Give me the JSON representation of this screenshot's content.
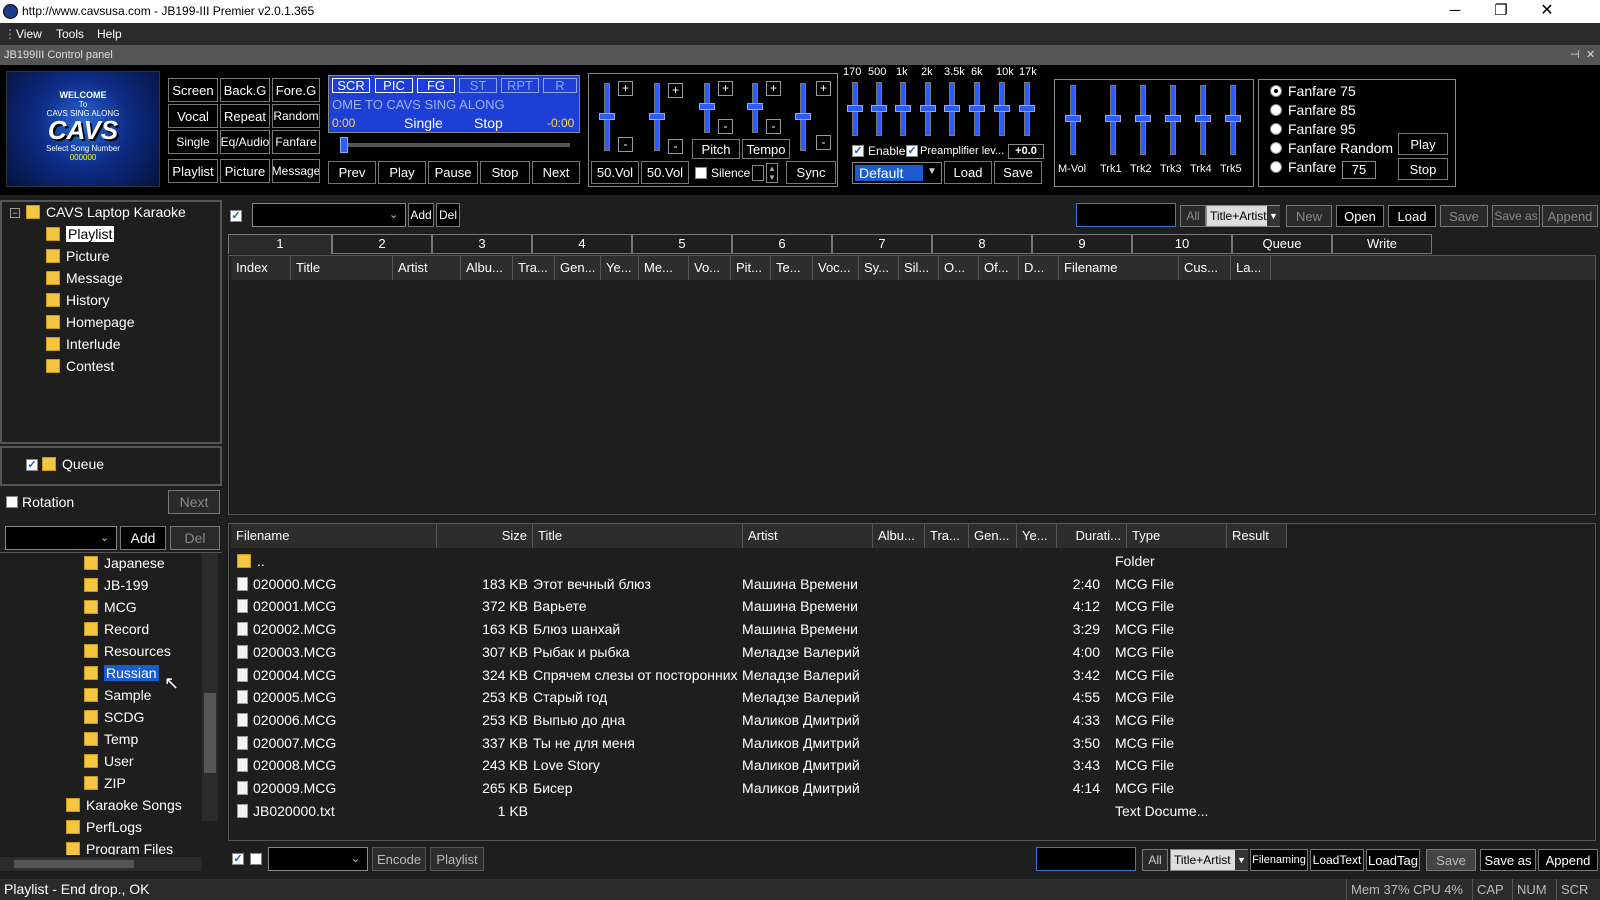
{
  "window": {
    "title": "http://www.cavsusa.com - JB199-III Premier v2.0.1.365",
    "min": "─",
    "restore": "❐",
    "close": "✕"
  },
  "menu": {
    "items": [
      "View",
      "Tools",
      "Help"
    ]
  },
  "control_panel": {
    "title": "JB199III Control panel",
    "logo": {
      "welcome": "WELCOME",
      "to": "To",
      "tagline": "CAVS SING ALONG",
      "brand": "CAVS",
      "select": "Select Song Number",
      "number": "000000"
    },
    "mode_buttons": [
      "Screen",
      "Back.G",
      "Fore.G",
      "Vocal",
      "Repeat",
      "Random",
      "Single",
      "Eq/Audio",
      "Fanfare",
      "Playlist",
      "Picture",
      "Message"
    ],
    "display": {
      "tags": [
        "SCR",
        "PIC",
        "FG",
        "ST",
        "RPT",
        "R"
      ],
      "marquee": "OME TO CAVS SING ALONG",
      "elapsed": "0:00",
      "mode": "Single",
      "state": "Stop",
      "remaining": "-0:00"
    },
    "transport": [
      "Prev",
      "Play",
      "Pause",
      "Stop",
      "Next"
    ],
    "vol": {
      "plus": "+",
      "minus": "-",
      "vol1": "50.Vol",
      "vol2": "50.Vol",
      "pitch": "Pitch",
      "tempo": "Tempo",
      "silence": "Silence",
      "sync": "Sync"
    },
    "eq": {
      "freqs": [
        "170",
        "500",
        "1k",
        "2k",
        "3.5k",
        "6k",
        "10k",
        "17k"
      ],
      "enable": "Enable",
      "preamp": "Preamplifier lev...",
      "preamp_val": "+0.0",
      "preset": "Default",
      "load": "Load",
      "save": "Save"
    },
    "mixer": {
      "labels": [
        "M-Vol",
        "Trk1",
        "Trk2",
        "Trk3",
        "Trk4",
        "Trk5"
      ]
    },
    "fanfare": {
      "options": [
        "Fanfare 75",
        "Fanfare 85",
        "Fanfare 95",
        "Fanfare Random",
        "Fanfare"
      ],
      "value": "75",
      "play": "Play",
      "stop": "Stop"
    }
  },
  "tree": {
    "root": "CAVS Laptop Karaoke",
    "items": [
      "Playlist",
      "Picture",
      "Message",
      "History",
      "Homepage",
      "Interlude",
      "Contest"
    ]
  },
  "queue": {
    "label": "Queue",
    "rotation": "Rotation",
    "next": "Next"
  },
  "folder_bar": {
    "add": "Add",
    "del": "Del"
  },
  "folders": {
    "items": [
      "Japanese",
      "JB-199",
      "MCG",
      "Record",
      "Resources",
      "Russian",
      "Sample",
      "SCDG",
      "Temp",
      "User",
      "ZIP"
    ],
    "top": [
      "Karaoke Songs",
      "PerfLogs",
      "Program Files"
    ]
  },
  "playlist_toolbar": {
    "add": "Add",
    "del": "Del",
    "all": "All",
    "sort": "Title+Artist",
    "new": "New",
    "open": "Open",
    "load": "Load",
    "save": "Save",
    "saveas": "Save as",
    "append": "Append"
  },
  "playlist_tabs": [
    "1",
    "2",
    "3",
    "4",
    "5",
    "6",
    "7",
    "8",
    "9",
    "10",
    "Queue",
    "Write"
  ],
  "playlist_columns": [
    "Index",
    "Title",
    "Artist",
    "Albu...",
    "Tra...",
    "Gen...",
    "Ye...",
    "Me...",
    "Vo...",
    "Pit...",
    "Te...",
    "Voc...",
    "Sy...",
    "Sil...",
    "O...",
    "Of...",
    "D...",
    "Filename",
    "Cus...",
    "La..."
  ],
  "file_columns": [
    "Filename",
    "Size",
    "Title",
    "Artist",
    "Albu...",
    "Tra...",
    "Gen...",
    "Ye...",
    "Durati...",
    "Type",
    "Result"
  ],
  "files": [
    {
      "name": "..",
      "size": "",
      "title": "",
      "artist": "",
      "dur": "",
      "type": "Folder",
      "icon": "folder"
    },
    {
      "name": "020000.MCG",
      "size": "183 KB",
      "title": "Этот вечный блюз",
      "artist": "Машина Времени",
      "dur": "2:40",
      "type": "MCG File",
      "icon": "file"
    },
    {
      "name": "020001.MCG",
      "size": "372 KB",
      "title": "Варьете",
      "artist": "Машина Времени",
      "dur": "4:12",
      "type": "MCG File",
      "icon": "file"
    },
    {
      "name": "020002.MCG",
      "size": "163 KB",
      "title": "Блюз шанхай",
      "artist": "Машина Времени",
      "dur": "3:29",
      "type": "MCG File",
      "icon": "file"
    },
    {
      "name": "020003.MCG",
      "size": "307 KB",
      "title": "Рыбак и рыбка",
      "artist": "Меладзе Валерий",
      "dur": "4:00",
      "type": "MCG File",
      "icon": "file"
    },
    {
      "name": "020004.MCG",
      "size": "324 KB",
      "title": "Спрячем слезы от посторонних",
      "artist": "Меладзе Валерий",
      "dur": "3:42",
      "type": "MCG File",
      "icon": "file"
    },
    {
      "name": "020005.MCG",
      "size": "253 KB",
      "title": "Старый год",
      "artist": "Меладзе Валерий",
      "dur": "4:55",
      "type": "MCG File",
      "icon": "file"
    },
    {
      "name": "020006.MCG",
      "size": "253 KB",
      "title": "Выпью до дна",
      "artist": "Маликов Дмитрий",
      "dur": "4:33",
      "type": "MCG File",
      "icon": "file"
    },
    {
      "name": "020007.MCG",
      "size": "337 KB",
      "title": "Ты не для меня",
      "artist": "Маликов Дмитрий",
      "dur": "3:50",
      "type": "MCG File",
      "icon": "file"
    },
    {
      "name": "020008.MCG",
      "size": "243 KB",
      "title": "Love Story",
      "artist": "Маликов Дмитрий",
      "dur": "3:43",
      "type": "MCG File",
      "icon": "file"
    },
    {
      "name": "020009.MCG",
      "size": "265 KB",
      "title": "Бисер",
      "artist": "Маликов Дмитрий",
      "dur": "4:14",
      "type": "MCG File",
      "icon": "file"
    },
    {
      "name": "JB020000.txt",
      "size": "1 KB",
      "title": "",
      "artist": "",
      "dur": "",
      "type": "Text Docume...",
      "icon": "file"
    }
  ],
  "bottom_toolbar": {
    "encode": "Encode",
    "playlist": "Playlist",
    "all": "All",
    "sort": "Title+Artist",
    "filenaming": "Filenaming",
    "loadtext": "LoadText",
    "loadtag": "LoadTag",
    "save": "Save",
    "saveas": "Save as",
    "append": "Append"
  },
  "status": {
    "message": "Playlist - End drop., OK",
    "mem": "Mem 37% CPU  4%",
    "cap": "CAP",
    "num": "NUM",
    "scr": "SCR"
  }
}
